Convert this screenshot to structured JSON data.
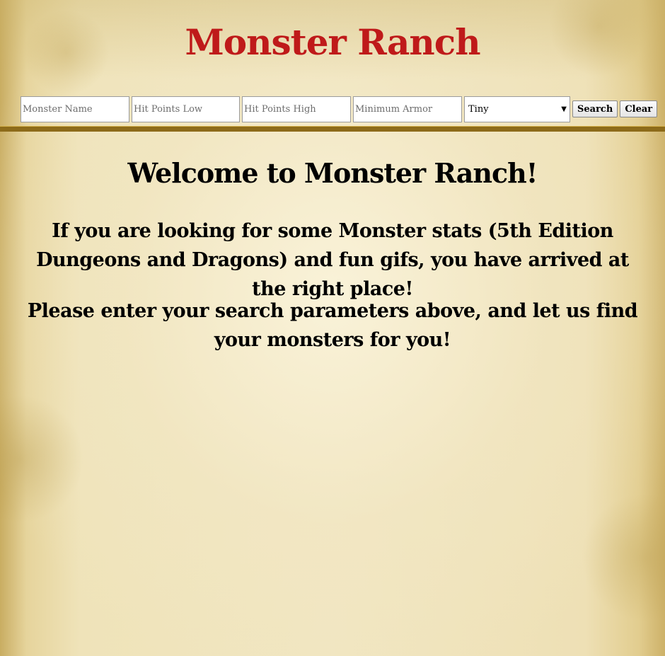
{
  "header": {
    "title": "Monster Ranch"
  },
  "search": {
    "name_placeholder": "Monster Name",
    "hp_low_placeholder": "Hit Points Low",
    "hp_high_placeholder": "Hit Points High",
    "armor_placeholder": "Minimum Armor",
    "size_selected": "Tiny",
    "search_label": "Search",
    "clear_label": "Clear"
  },
  "main": {
    "heading": "Welcome to Monster Ranch!",
    "intro": "If you are looking for some Monster stats (5th Edition Dungeons and Dragons) and fun gifs, you have arrived at the right place!",
    "instructions": "Please enter your search parameters above, and let us find your monsters for you!"
  },
  "colors": {
    "title": "#bf1a1a",
    "divider": "#8d6b1a",
    "text": "#000000",
    "parchment": "#f1e6c1"
  }
}
